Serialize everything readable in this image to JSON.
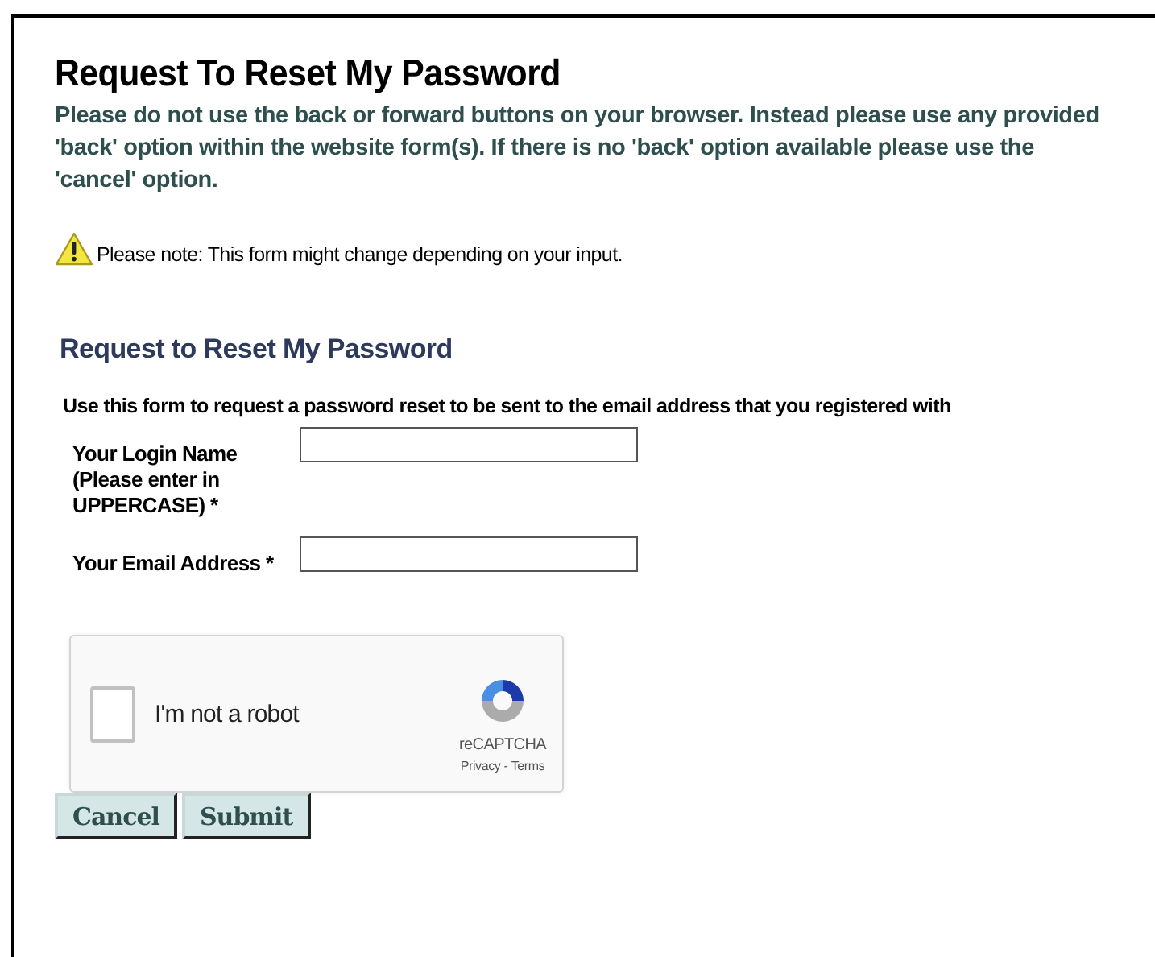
{
  "title": "Request To Reset My Password",
  "warning": "Please do not use the back or forward buttons on your browser. Instead please use any provided 'back' option within the website form(s). If there is no 'back' option available please use the 'cancel' option.",
  "note": "Please note: This form might change depending on your input.",
  "form": {
    "heading": "Request to Reset My Password",
    "instruction": "Use this form to request a password reset to be sent to the email address that you registered with",
    "fields": [
      {
        "label": "Your Login Name (Please enter in UPPERCASE) *"
      },
      {
        "label": "Your Email Address *"
      }
    ]
  },
  "captcha": {
    "label": "I'm not a robot",
    "checked": false,
    "brand": "reCAPTCHA",
    "links": [
      "Privacy",
      "Terms"
    ],
    "separator": "-"
  },
  "buttons": [
    "Cancel",
    "Submit"
  ]
}
